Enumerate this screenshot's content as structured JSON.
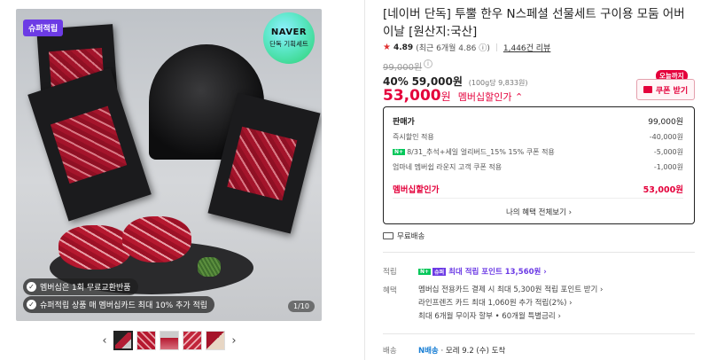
{
  "gallery": {
    "store_badge": "슈퍼적립",
    "naver_badge": {
      "line1": "NAVER",
      "line2": "단독 기획세트"
    },
    "promos": [
      "멤버십은 1회 무료교환반품",
      "슈퍼적립 상품 매 멤버십카드 최대 10% 추가 적립"
    ],
    "counter": "1/10",
    "thumbs": [
      "t1",
      "t2",
      "t3",
      "t4",
      "t5"
    ],
    "prev": "‹",
    "next": "›"
  },
  "product": {
    "title": "[네이버 단독] 투뿔 한우 N스페셜 선물세트 구이용 모둠 어버이날 [원산지:국산]",
    "rating": "4.89",
    "rating_detail": "(최근 6개월 4.86",
    "review_count": "1,446건 리뷰",
    "original_price": "99,000원",
    "discount_rate": "40%",
    "sale_price": "59,000원",
    "unit_price": "(100g당 9,833원)",
    "member_price": "53,000",
    "member_won": "원",
    "member_label": "멤버십할인가 ⌃",
    "today_tag": "오늘까지",
    "coupon_label": "쿠폰 받기"
  },
  "calc": {
    "head": {
      "label": "판매가",
      "value": "99,000원"
    },
    "rows": [
      {
        "label": "즉시할인 적용",
        "value": "-40,000원"
      },
      {
        "label": "8/31_추석+세일 얼리버드_15% 15% 쿠폰 적용",
        "value": "-5,000원"
      },
      {
        "label": "엄마네 멤버쉽 라운지 고객 쿠폰 적용",
        "value": "-1,000원"
      }
    ],
    "final": {
      "label": "멤버십할인가",
      "value": "53,000원"
    },
    "benefit_link": "나의 혜택 전체보기 ›",
    "npay_tag": "N+"
  },
  "shipping": {
    "label": "무료배송"
  },
  "points": {
    "label": "적립",
    "tags": [
      "N+",
      "슈퍼"
    ],
    "text": "최대 적립 포인트 13,560원 ›"
  },
  "benefits": {
    "label": "혜택",
    "items": [
      "멤버십 전용카드 결제 시 최대 5,300원 적립 포인트 받기 ›",
      "라인프렌즈 카드 최대 1,060원 추가 적립(2%) ›",
      "최대 6개월 무이자 할부 • 60개월 특별금리 ›"
    ]
  },
  "delivery": {
    "label": "배송",
    "tag": "N배송",
    "text": "· 모레 9.2 (수) 도착"
  }
}
